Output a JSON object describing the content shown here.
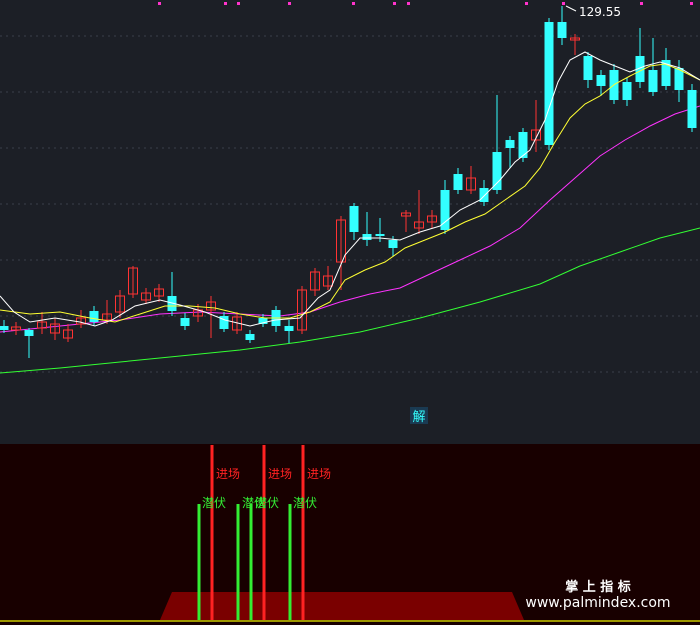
{
  "main_panel": {
    "peak_label": "129.55",
    "jie_badge": "解",
    "ma_colors": {
      "ma5": "#ffffff",
      "ma10": "#ffff33",
      "ma20": "#ff33ff",
      "ma60": "#33ff33"
    },
    "up_color": "#ff3333",
    "down_color": "#33ffff"
  },
  "indicator_panel": {
    "entry_label": "进场",
    "ambush_label": "潜伏",
    "entry_color": "#ff2222",
    "ambush_color": "#33ee33"
  },
  "watermark": {
    "line1": "掌 上 指 标",
    "line2": "www.palmindex.com"
  },
  "chart_data": {
    "type": "candlestick",
    "candles": [
      [
        0,
        100,
        99,
        101,
        98
      ],
      [
        1,
        99,
        100,
        101,
        98
      ]
    ],
    "peak_value": 129.55
  }
}
